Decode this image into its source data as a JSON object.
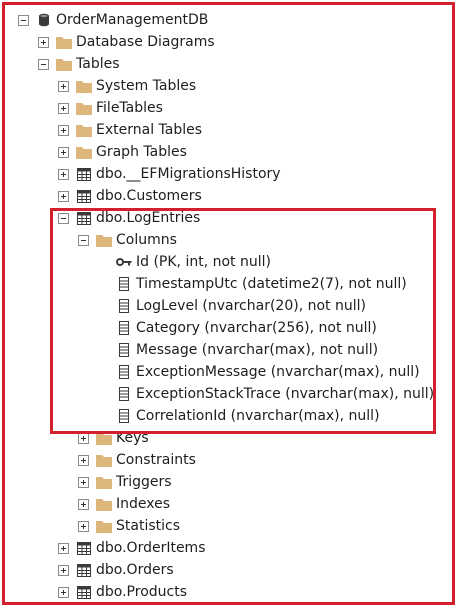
{
  "colors": {
    "highlight_border": "#d3202e",
    "folder": "#dcb67a",
    "text": "#1e1e1e"
  },
  "tree": {
    "root": {
      "label": "OrderManagementDB",
      "icon": "database-icon",
      "state": "expanded"
    },
    "database_diagrams": {
      "label": "Database Diagrams",
      "icon": "folder-icon",
      "state": "collapsed"
    },
    "tables": {
      "label": "Tables",
      "icon": "folder-icon",
      "state": "expanded"
    },
    "system_tables": {
      "label": "System Tables",
      "icon": "folder-icon",
      "state": "collapsed"
    },
    "file_tables": {
      "label": "FileTables",
      "icon": "folder-icon",
      "state": "collapsed"
    },
    "external_tables": {
      "label": "External Tables",
      "icon": "folder-icon",
      "state": "collapsed"
    },
    "graph_tables": {
      "label": "Graph Tables",
      "icon": "folder-icon",
      "state": "collapsed"
    },
    "ef_history": {
      "label": "dbo.__EFMigrationsHistory",
      "icon": "table-icon",
      "state": "collapsed"
    },
    "customers": {
      "label": "dbo.Customers",
      "icon": "table-icon",
      "state": "collapsed"
    },
    "log_entries": {
      "label": "dbo.LogEntries",
      "icon": "table-icon",
      "state": "expanded"
    },
    "columns": {
      "label": "Columns",
      "icon": "folder-icon",
      "state": "expanded"
    },
    "column_items": [
      {
        "label": "Id (PK, int, not null)",
        "icon": "key-icon"
      },
      {
        "label": "TimestampUtc (datetime2(7), not null)",
        "icon": "column-icon"
      },
      {
        "label": "LogLevel (nvarchar(20), not null)",
        "icon": "column-icon"
      },
      {
        "label": "Category (nvarchar(256), not null)",
        "icon": "column-icon"
      },
      {
        "label": "Message (nvarchar(max), not null)",
        "icon": "column-icon"
      },
      {
        "label": "ExceptionMessage (nvarchar(max), null)",
        "icon": "column-icon"
      },
      {
        "label": "ExceptionStackTrace (nvarchar(max), null)",
        "icon": "column-icon"
      },
      {
        "label": "CorrelationId (nvarchar(max), null)",
        "icon": "column-icon"
      }
    ],
    "keys": {
      "label": "Keys",
      "icon": "folder-icon",
      "state": "collapsed"
    },
    "constraints": {
      "label": "Constraints",
      "icon": "folder-icon",
      "state": "collapsed"
    },
    "triggers": {
      "label": "Triggers",
      "icon": "folder-icon",
      "state": "collapsed"
    },
    "indexes": {
      "label": "Indexes",
      "icon": "folder-icon",
      "state": "collapsed"
    },
    "statistics": {
      "label": "Statistics",
      "icon": "folder-icon",
      "state": "collapsed"
    },
    "order_items": {
      "label": "dbo.OrderItems",
      "icon": "table-icon",
      "state": "collapsed"
    },
    "orders": {
      "label": "dbo.Orders",
      "icon": "table-icon",
      "state": "collapsed"
    },
    "products": {
      "label": "dbo.Products",
      "icon": "table-icon",
      "state": "collapsed"
    }
  }
}
